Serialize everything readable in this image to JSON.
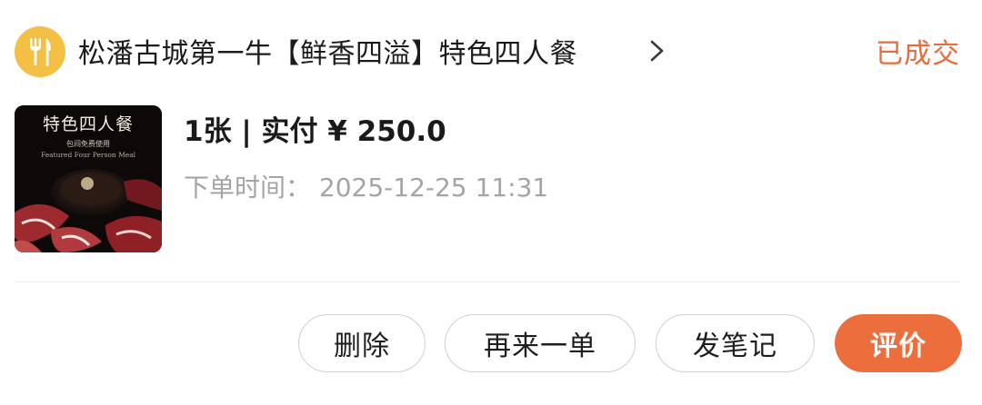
{
  "header": {
    "store_icon": "fork-knife-icon",
    "store_name": "松潘古城第一牛【鲜香四溢】特色四人餐",
    "chevron_icon": "chevron-right-icon",
    "status": "已成交",
    "status_color": "#e96a3a",
    "icon_color": "#f3bf45"
  },
  "product": {
    "thumbnail": {
      "title": "特色四人餐",
      "subtitle": "包间免费使用",
      "english": "Featured Four Person Meal"
    },
    "summary": "1张 | 实付 ¥ 250.0",
    "order_time": "下单时间： 2025-12-25 11:31"
  },
  "actions": {
    "delete_label": "删除",
    "reorder_label": "再来一单",
    "note_label": "发笔记",
    "review_label": "评价",
    "accent_color": "#ec6e3d"
  }
}
